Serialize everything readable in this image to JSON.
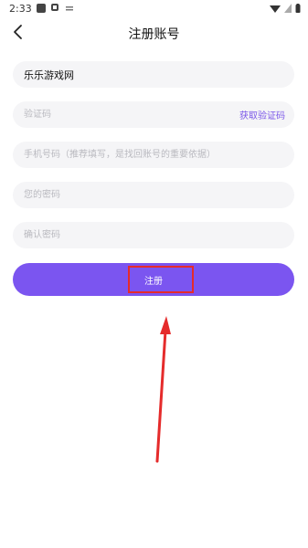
{
  "status_bar": {
    "time": "2:33"
  },
  "header": {
    "title": "注册账号",
    "back_icon": "chevron-left-icon"
  },
  "form": {
    "username_value": "乐乐游戏网",
    "code_placeholder": "验证码",
    "get_code_label": "获取验证码",
    "phone_placeholder": "手机号码（推荐填写，是找回账号的重要依据）",
    "password_placeholder": "您的密码",
    "confirm_placeholder": "确认密码",
    "register_label": "注册"
  },
  "colors": {
    "accent": "#7b55f0",
    "annotation": "#e52b2b",
    "field_bg": "#f5f5f7"
  }
}
